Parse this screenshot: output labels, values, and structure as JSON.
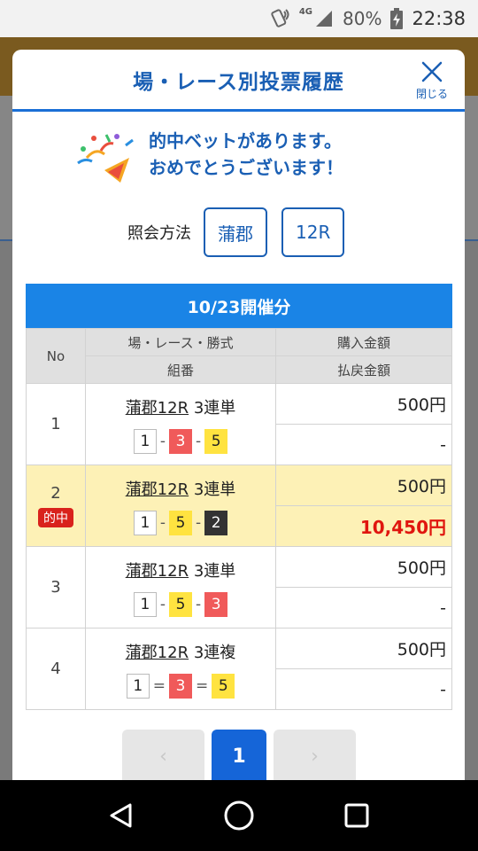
{
  "status_bar": {
    "network": "4G",
    "battery": "80%",
    "time": "22:38"
  },
  "modal": {
    "title": "場・レース別投票履歴",
    "close_label": "閉じる",
    "congrats_line1": "的中ベットがあります。",
    "congrats_line2": "おめでとうございます！",
    "inquiry_label": "照会方法",
    "inquiry_venue": "蒲郡",
    "inquiry_race": "12R"
  },
  "table": {
    "date_header": "10/23開催分",
    "headers": {
      "no": "No",
      "race": "場・レース・勝式",
      "combo": "組番",
      "purchase": "購入金額",
      "payout": "払戻金額"
    },
    "rows": [
      {
        "no": "1",
        "race_venue": "蒲郡12R",
        "bet_type": "3連単",
        "n1": "1",
        "n2": "3",
        "n3": "5",
        "s1": "-",
        "s2": "-",
        "purchase": "500円",
        "payout": "-"
      },
      {
        "no": "2",
        "hit_badge": "的中",
        "race_venue": "蒲郡12R",
        "bet_type": "3連単",
        "n1": "1",
        "n2": "5",
        "n3": "2",
        "s1": "-",
        "s2": "-",
        "purchase": "500円",
        "payout": "10,450円"
      },
      {
        "no": "3",
        "race_venue": "蒲郡12R",
        "bet_type": "3連単",
        "n1": "1",
        "n2": "5",
        "n3": "3",
        "s1": "-",
        "s2": "-",
        "purchase": "500円",
        "payout": "-"
      },
      {
        "no": "4",
        "race_venue": "蒲郡12R",
        "bet_type": "3連複",
        "n1": "1",
        "n2": "3",
        "n3": "5",
        "s1": "=",
        "s2": "=",
        "purchase": "500円",
        "payout": "-"
      }
    ]
  },
  "pagination": {
    "prev": "‹",
    "current": "1",
    "next": "›"
  },
  "colors": {
    "accent": "#1a5fb4",
    "date_bar": "#1a84e6",
    "hit_row": "#fdf1b6",
    "hit_badge": "#d9221c",
    "payout_hit": "#e0160f",
    "current_page": "#1565d8"
  }
}
